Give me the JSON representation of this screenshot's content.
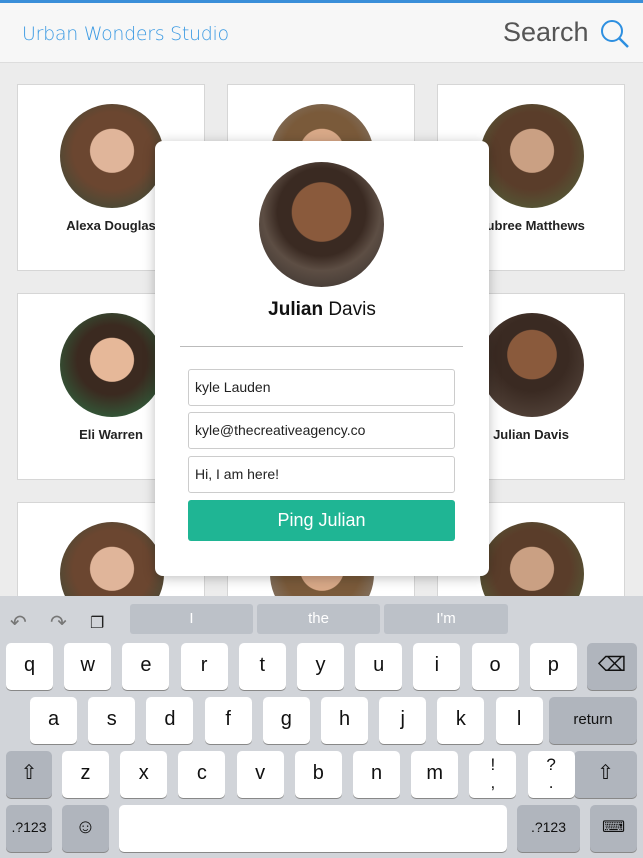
{
  "header": {
    "title": "Urban Wonders Studio",
    "search_label": "Search"
  },
  "cards": [
    {
      "name": "Alexa Douglas"
    },
    {
      "name": ""
    },
    {
      "name": "Aubree Matthews"
    },
    {
      "name": "Eli Warren"
    },
    {
      "name": ""
    },
    {
      "name": "Julian Davis"
    }
  ],
  "modal": {
    "first_name": "Julian",
    "last_name": "Davis",
    "name_value": "kyle Lauden",
    "email_value": "kyle@thecreativeagency.co",
    "message_value": "Hi, I am here!",
    "button_label": "Ping Julian"
  },
  "keyboard": {
    "suggestions": [
      "I",
      "the",
      "I'm"
    ],
    "row1": [
      "q",
      "w",
      "e",
      "r",
      "t",
      "y",
      "u",
      "i",
      "o",
      "p"
    ],
    "row2": [
      "a",
      "s",
      "d",
      "f",
      "g",
      "h",
      "j",
      "k",
      "l"
    ],
    "row3": [
      "z",
      "x",
      "c",
      "v",
      "b",
      "n",
      "m",
      "!\n,",
      "?\n."
    ],
    "return": "return",
    "numbers": ".?123"
  },
  "colors": {
    "accent": "#3d9be3",
    "button": "#1fb594"
  }
}
